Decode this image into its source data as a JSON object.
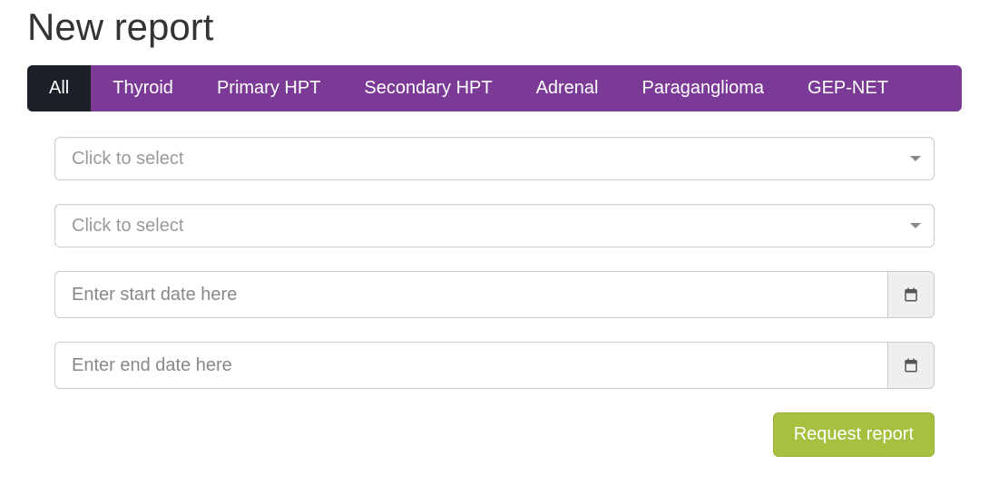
{
  "title": "New report",
  "tabs": [
    {
      "label": "All",
      "active": true
    },
    {
      "label": "Thyroid",
      "active": false
    },
    {
      "label": "Primary HPT",
      "active": false
    },
    {
      "label": "Secondary HPT",
      "active": false
    },
    {
      "label": "Adrenal",
      "active": false
    },
    {
      "label": "Paraganglioma",
      "active": false
    },
    {
      "label": "GEP-NET",
      "active": false
    }
  ],
  "selects": {
    "first_placeholder": "Click to select",
    "second_placeholder": "Click to select"
  },
  "dates": {
    "start_placeholder": "Enter start date here",
    "end_placeholder": "Enter end date here"
  },
  "buttons": {
    "submit": "Request report"
  },
  "colors": {
    "tab_bg": "#7b3a96",
    "tab_active_bg": "#1c2029",
    "primary_btn": "#a8c03f"
  }
}
